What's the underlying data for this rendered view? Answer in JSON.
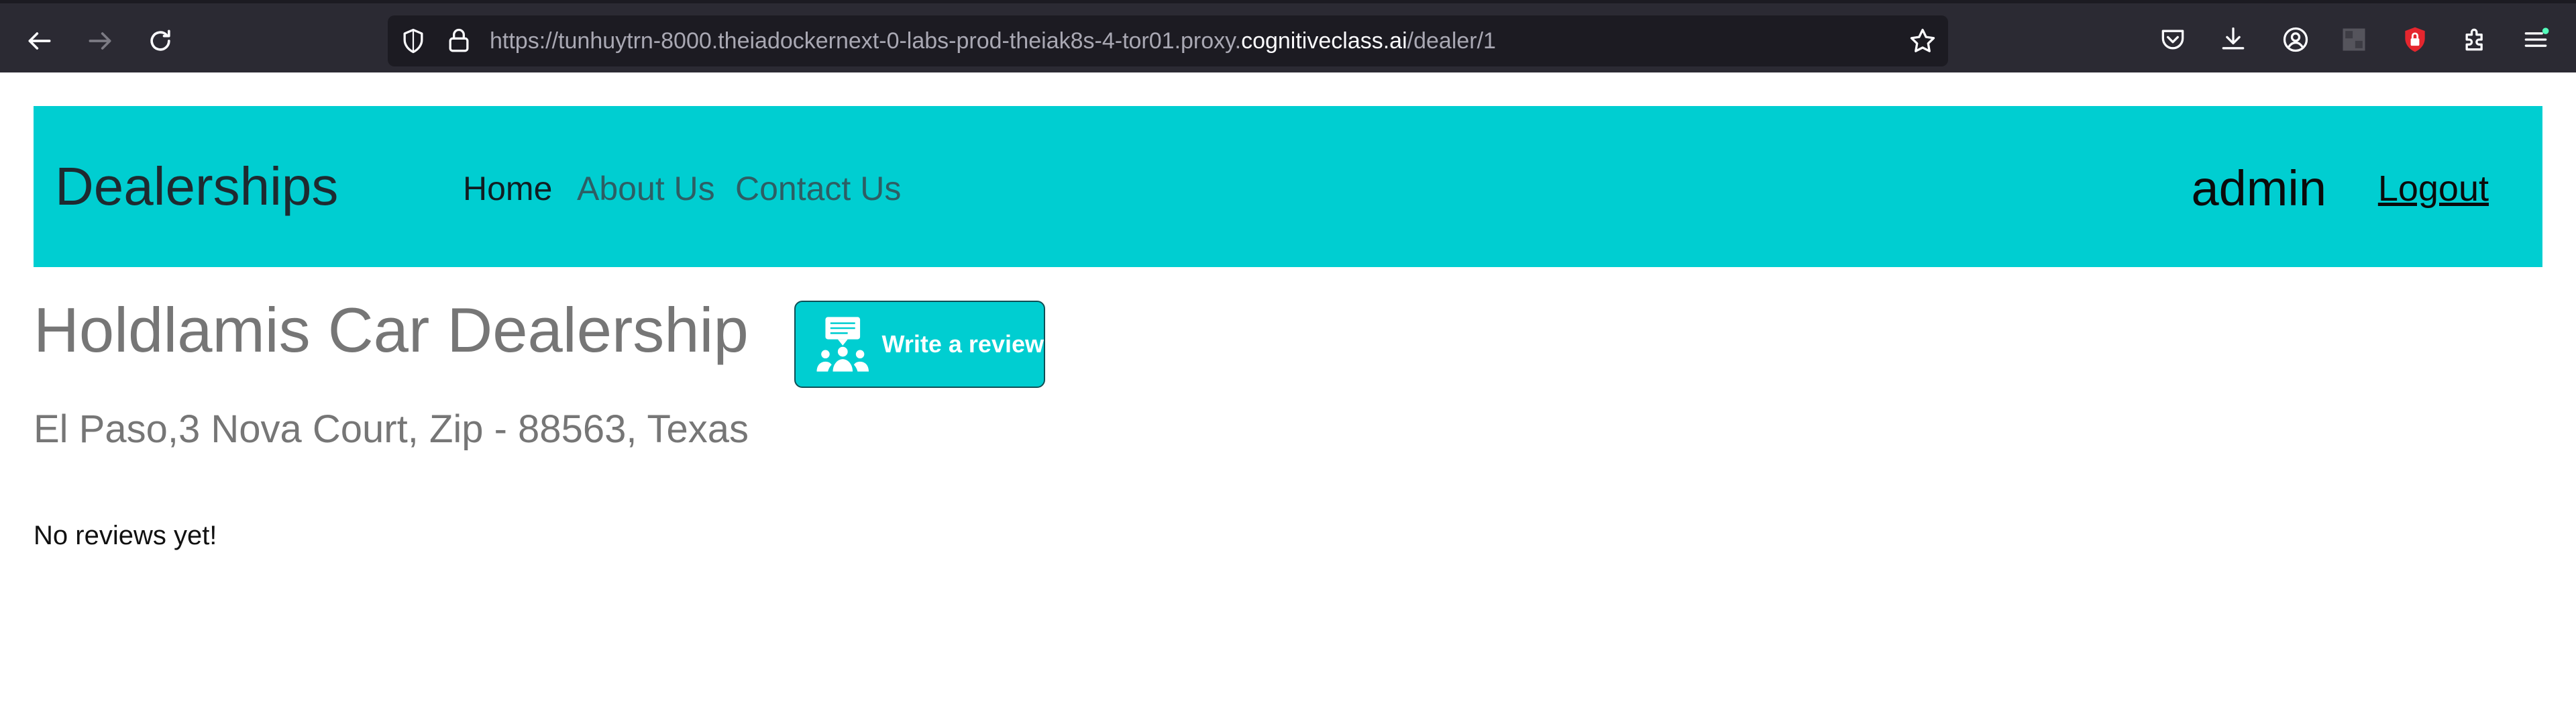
{
  "browser": {
    "url_prefix": "https://tunhuytrn-8000.theiadockernext-0-labs-prod-theiak8s-4-tor01.proxy.",
    "url_host": "cognitiveclass.ai",
    "url_path": "/dealer/1",
    "icons": [
      "back-icon",
      "forward-icon",
      "reload-icon",
      "shield-icon",
      "lock-icon",
      "bookmark-star-icon",
      "pocket-icon",
      "download-icon",
      "account-icon",
      "extension-sq-icon",
      "extension-red-icon",
      "extensions-icon",
      "menu-icon"
    ]
  },
  "nav": {
    "brand": "Dealerships",
    "links": [
      "Home",
      "About Us",
      "Contact Us"
    ],
    "user": "admin",
    "logout": "Logout",
    "background": "#00ced1"
  },
  "dealer": {
    "name": "Holdlamis Car Dealership",
    "address": "El Paso,3 Nova Court, Zip - 88563, Texas",
    "review_button": "Write a review",
    "no_reviews": "No reviews yet!"
  }
}
